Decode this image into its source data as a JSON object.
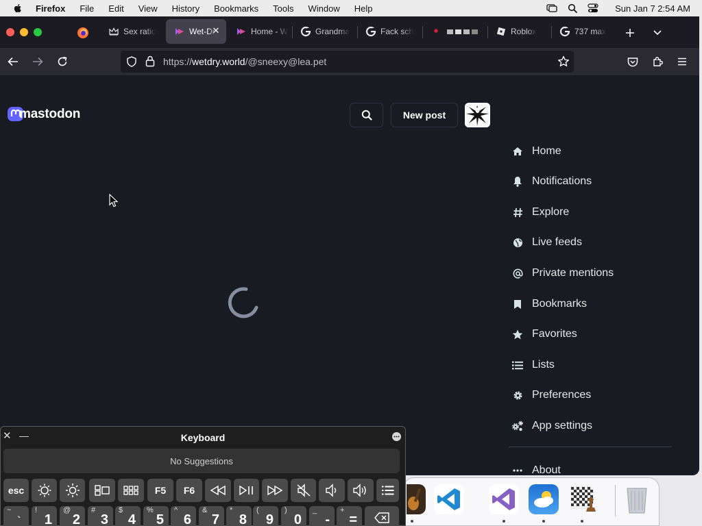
{
  "menubar": {
    "app_name": "Firefox",
    "menus": [
      "File",
      "Edit",
      "View",
      "History",
      "Bookmarks",
      "Tools",
      "Window",
      "Help"
    ],
    "clock": "Sun Jan 7  2:54 AM"
  },
  "browser": {
    "tabs": [
      {
        "title": "Sex ratio",
        "icon": "crown-icon",
        "active": false
      },
      {
        "title": "Wet-Dry",
        "icon": "mastodon-favicon",
        "active": true
      },
      {
        "title": "Home - W",
        "icon": "mastodon-favicon",
        "active": false
      },
      {
        "title": "Grandma",
        "icon": "google-icon",
        "active": false
      },
      {
        "title": "Fack sch",
        "icon": "google-icon",
        "active": false
      },
      {
        "title": "",
        "icon": "red-dot-icon",
        "active": false
      },
      {
        "title": "Roblox",
        "icon": "roblox-icon",
        "active": false
      },
      {
        "title": "737 max",
        "icon": "google-icon",
        "active": false
      }
    ],
    "url_prefix": "https://",
    "url_domain": "wetdry.world",
    "url_path": "/@sneexy@lea.pet"
  },
  "page": {
    "logo_text": "mastodon",
    "new_post_label": "New post",
    "nav": [
      {
        "label": "Home",
        "icon": "home-icon"
      },
      {
        "label": "Notifications",
        "icon": "bell-icon"
      },
      {
        "label": "Explore",
        "icon": "hashtag-icon"
      },
      {
        "label": "Live feeds",
        "icon": "globe-icon"
      },
      {
        "label": "Private mentions",
        "icon": "at-icon"
      },
      {
        "label": "Bookmarks",
        "icon": "bookmark-icon"
      },
      {
        "label": "Favorites",
        "icon": "star-icon"
      },
      {
        "label": "Lists",
        "icon": "list-icon"
      },
      {
        "label": "Preferences",
        "icon": "gear-icon"
      },
      {
        "label": "App settings",
        "icon": "gears-icon"
      },
      {
        "label": "About",
        "icon": "ellipsis-icon"
      }
    ]
  },
  "keyboard": {
    "title": "Keyboard",
    "suggestion_text": "No Suggestions",
    "top_row": [
      "esc",
      "",
      "",
      "",
      "",
      "F5",
      "F6",
      "",
      "",
      "",
      "",
      "",
      "",
      ""
    ],
    "number_row": [
      {
        "shift": "~",
        "main": "`"
      },
      {
        "shift": "!",
        "main": "1"
      },
      {
        "shift": "@",
        "main": "2"
      },
      {
        "shift": "#",
        "main": "3"
      },
      {
        "shift": "$",
        "main": "4"
      },
      {
        "shift": "%",
        "main": "5"
      },
      {
        "shift": "^",
        "main": "6"
      },
      {
        "shift": "&",
        "main": "7"
      },
      {
        "shift": "*",
        "main": "8"
      },
      {
        "shift": "(",
        "main": "9"
      },
      {
        "shift": ")",
        "main": "0"
      },
      {
        "shift": "_",
        "main": "-"
      },
      {
        "shift": "+",
        "main": "="
      }
    ]
  },
  "colors": {
    "page_bg": "#191b22",
    "accent": "#6364ff",
    "tabstrip_bg": "#1c1b22",
    "toolbar_bg": "#2b2a33"
  }
}
